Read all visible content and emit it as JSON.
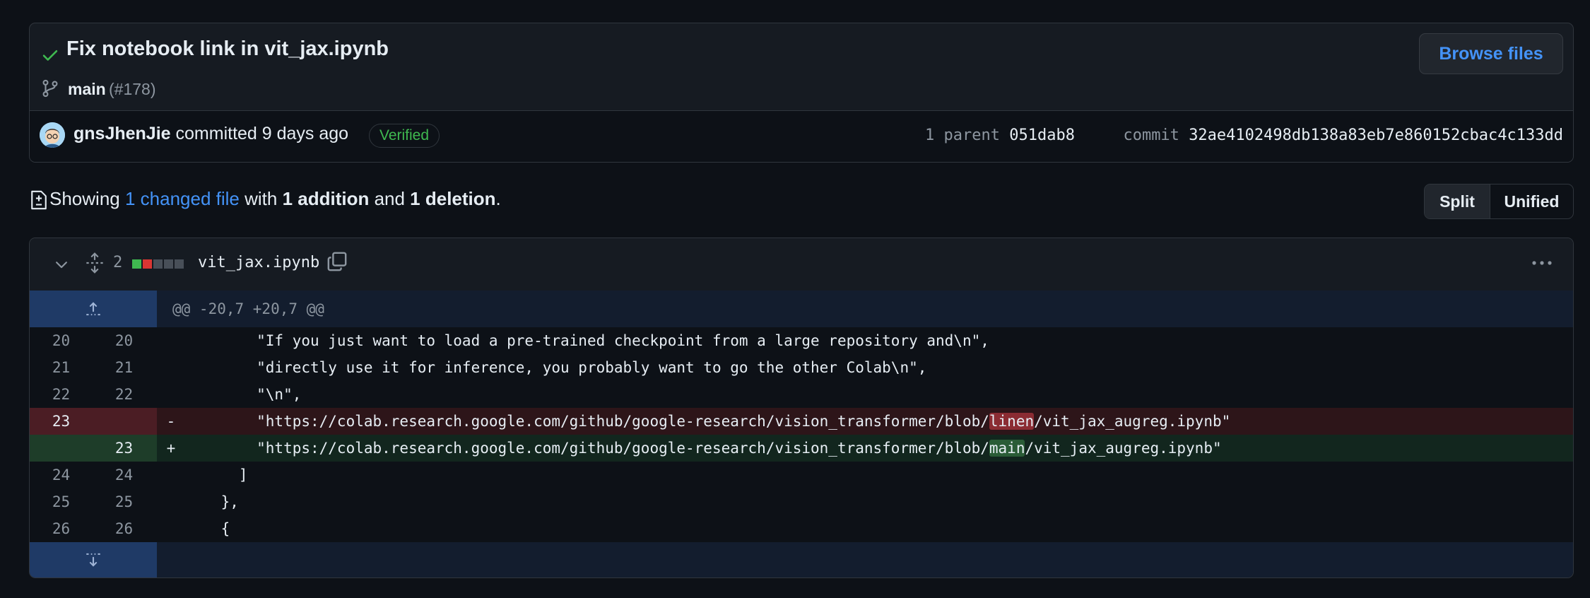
{
  "commit": {
    "title": "Fix notebook link in vit_jax.ipynb",
    "branch": "main",
    "pr": "(#178)",
    "browse_label": "Browse files",
    "author": "gnsJhenJie",
    "committed_text": " committed 9 days ago",
    "verified_label": "Verified",
    "parent_label": "1 parent",
    "parent_sha": "051dab8",
    "commit_label": "commit",
    "commit_sha": "32ae4102498db138a83eb7e860152cbac4c133dd"
  },
  "summary": {
    "prefix": "Showing ",
    "changed_link": "1 changed file",
    "with": " with ",
    "additions": "1 addition",
    "and": " and ",
    "deletions": "1 deletion",
    "suffix": "."
  },
  "view_toggle": {
    "split": "Split",
    "unified": "Unified"
  },
  "file": {
    "changes": "2",
    "name": "vit_jax.ipynb",
    "diffstat": [
      "added",
      "deleted",
      "neutral",
      "neutral",
      "neutral"
    ]
  },
  "diff": {
    "hunk_header": "@@ -20,7 +20,7 @@",
    "lines": [
      {
        "old": "20",
        "new": "20",
        "sign": "",
        "code": "        \"If you just want to load a pre-trained checkpoint from a large repository and\\n\","
      },
      {
        "old": "21",
        "new": "21",
        "sign": "",
        "code": "        \"directly use it for inference, you probably want to go the other Colab\\n\","
      },
      {
        "old": "22",
        "new": "22",
        "sign": "",
        "code": "        \"\\n\","
      },
      {
        "old": "23",
        "new": "",
        "sign": "-",
        "pre": "        \"https://colab.research.google.com/github/google-research/vision_transformer/blob/",
        "hl": "linen",
        "post": "/vit_jax_augreg.ipynb\""
      },
      {
        "old": "",
        "new": "23",
        "sign": "+",
        "pre": "        \"https://colab.research.google.com/github/google-research/vision_transformer/blob/",
        "hl": "main",
        "post": "/vit_jax_augreg.ipynb\""
      },
      {
        "old": "24",
        "new": "24",
        "sign": "",
        "code": "      ]"
      },
      {
        "old": "25",
        "new": "25",
        "sign": "",
        "code": "    },"
      },
      {
        "old": "26",
        "new": "26",
        "sign": "",
        "code": "    {"
      }
    ]
  },
  "colors": {
    "accent": "#4493f8",
    "added": "#3fb950",
    "deleted": "#f85149"
  }
}
